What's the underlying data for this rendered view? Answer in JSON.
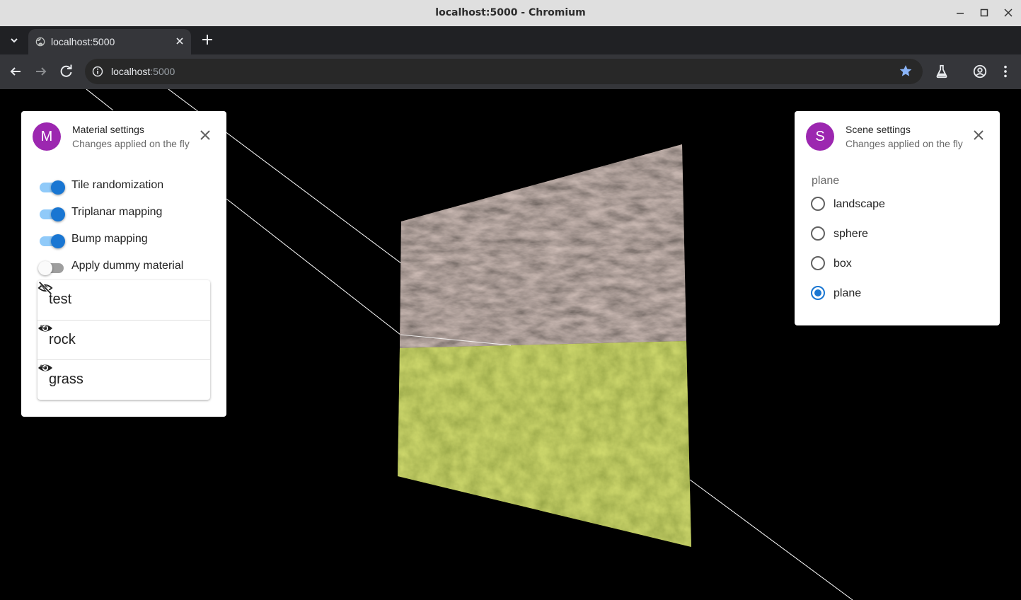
{
  "window": {
    "title": "localhost:5000 - Chromium",
    "minimize_icon": "minimize-icon",
    "maximize_icon": "maximize-icon",
    "close_icon": "close-icon"
  },
  "tabs": [
    {
      "label": "localhost:5000",
      "icon": "globe-icon",
      "active": true
    }
  ],
  "toolbar": {
    "url_host": "localhost",
    "url_port": ":5000",
    "bookmark_color": "#8ab4f8"
  },
  "material_panel": {
    "avatar": "M",
    "title": "Material settings",
    "subtitle": "Changes applied on the fly",
    "switches": [
      {
        "label": "Tile randomization",
        "checked": true
      },
      {
        "label": "Triplanar mapping",
        "checked": true
      },
      {
        "label": "Bump mapping",
        "checked": true
      },
      {
        "label": "Apply dummy material",
        "checked": false
      }
    ],
    "materials": [
      {
        "label": "test",
        "visible": false
      },
      {
        "label": "rock",
        "visible": true
      },
      {
        "label": "grass",
        "visible": true
      }
    ]
  },
  "scene_panel": {
    "avatar": "S",
    "title": "Scene settings",
    "subtitle": "Changes applied on the fly",
    "group_label": "plane",
    "options": [
      {
        "label": "landscape",
        "selected": false
      },
      {
        "label": "sphere",
        "selected": false
      },
      {
        "label": "box",
        "selected": false
      },
      {
        "label": "plane",
        "selected": true
      }
    ]
  },
  "colors": {
    "accent": "#1976d2",
    "avatar": "#9c27b0",
    "rock": "#6e5a55",
    "grass": "#7d8c22"
  }
}
